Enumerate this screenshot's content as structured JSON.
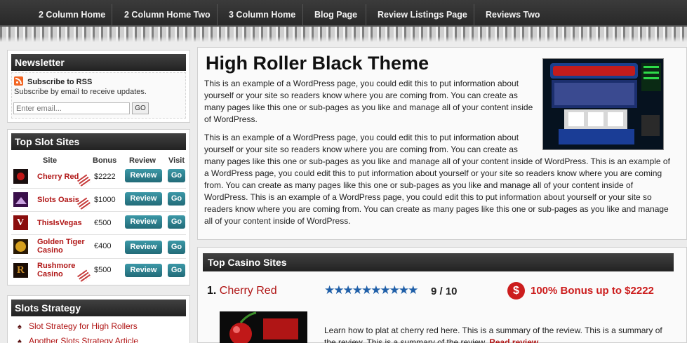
{
  "nav": {
    "items": [
      "2 Column Home",
      "2 Column Home Two",
      "3 Column Home",
      "Blog Page",
      "Review Listings Page",
      "Reviews Two"
    ]
  },
  "newsletter": {
    "title": "Newsletter",
    "rss_label": "Subscribe to RSS",
    "email_text": "Subscribe by email to receive updates.",
    "email_placeholder": "Enter email...",
    "go_label": "GO"
  },
  "top_slot": {
    "title": "Top Slot Sites",
    "headers": [
      "Site",
      "Bonus",
      "Review",
      "Visit"
    ],
    "review_label": "Review",
    "go_label": "Go",
    "rows": [
      {
        "name": "Cherry Red",
        "bonus": "$2222",
        "flag": "USA",
        "logo_icon": "cherry-red-logo-icon"
      },
      {
        "name": "Slots Oasis",
        "bonus": "$1000",
        "flag": "USA",
        "logo_icon": "slots-oasis-logo-icon"
      },
      {
        "name": "ThisIsVegas",
        "bonus": "€500",
        "flag": "",
        "logo_icon": "thisisvegas-logo-icon"
      },
      {
        "name": "Golden Tiger Casino",
        "bonus": "€400",
        "flag": "",
        "logo_icon": "golden-tiger-logo-icon"
      },
      {
        "name": "Rushmore Casino",
        "bonus": "$500",
        "flag": "USA",
        "logo_icon": "rushmore-logo-icon"
      }
    ]
  },
  "strategy": {
    "title": "Slots Strategy",
    "items": [
      "Slot Strategy for High Rollers",
      "Another Slots Strategy Article"
    ]
  },
  "page": {
    "title": "High Roller Black Theme",
    "para1": "This is an example of a WordPress page, you could edit this to put information about yourself or your site so readers know where you are coming from. You can create as many pages like this one or sub-pages as you like and manage all of your content inside of WordPress.",
    "para2a": "This is an example of a WordPress page, you could edit this to put information about yourself or your site so readers know where you are coming from. You can create as",
    "para2b": "many pages like this one or sub-pages as you like and manage all of your content inside of WordPress. This is an example of a WordPress page, you could edit this to put information about yourself or your site so readers know where you are coming from. You can create as many pages like this one or sub-pages as you like and manage all of your content inside of WordPress. This is an example of a WordPress page, you could edit this to put information about yourself or your site so readers know where you are coming from. You can create as many pages like this one or sub-pages as you like and manage all of your content inside of WordPress.",
    "image_icon": "slot-machine-image-icon"
  },
  "casino": {
    "title": "Top Casino Sites",
    "rank": "1.",
    "name": "Cherry Red",
    "stars": "★★★★★★★★★★",
    "rating": "9 / 10",
    "rating_value": 9,
    "rating_max": 10,
    "bonus": "100% Bonus up to $2222",
    "dollar_symbol": "$",
    "summary": "Learn how to plat at cherry red here. This is a summary of the review. This is a summary of the review. This is a summary of the review.",
    "read_more": "Read review"
  },
  "colors": {
    "accent_red": "#b01515",
    "button_teal": "#2b7f8d",
    "header_dark": "#2c2c2c",
    "star_blue": "#1f5fa8"
  }
}
